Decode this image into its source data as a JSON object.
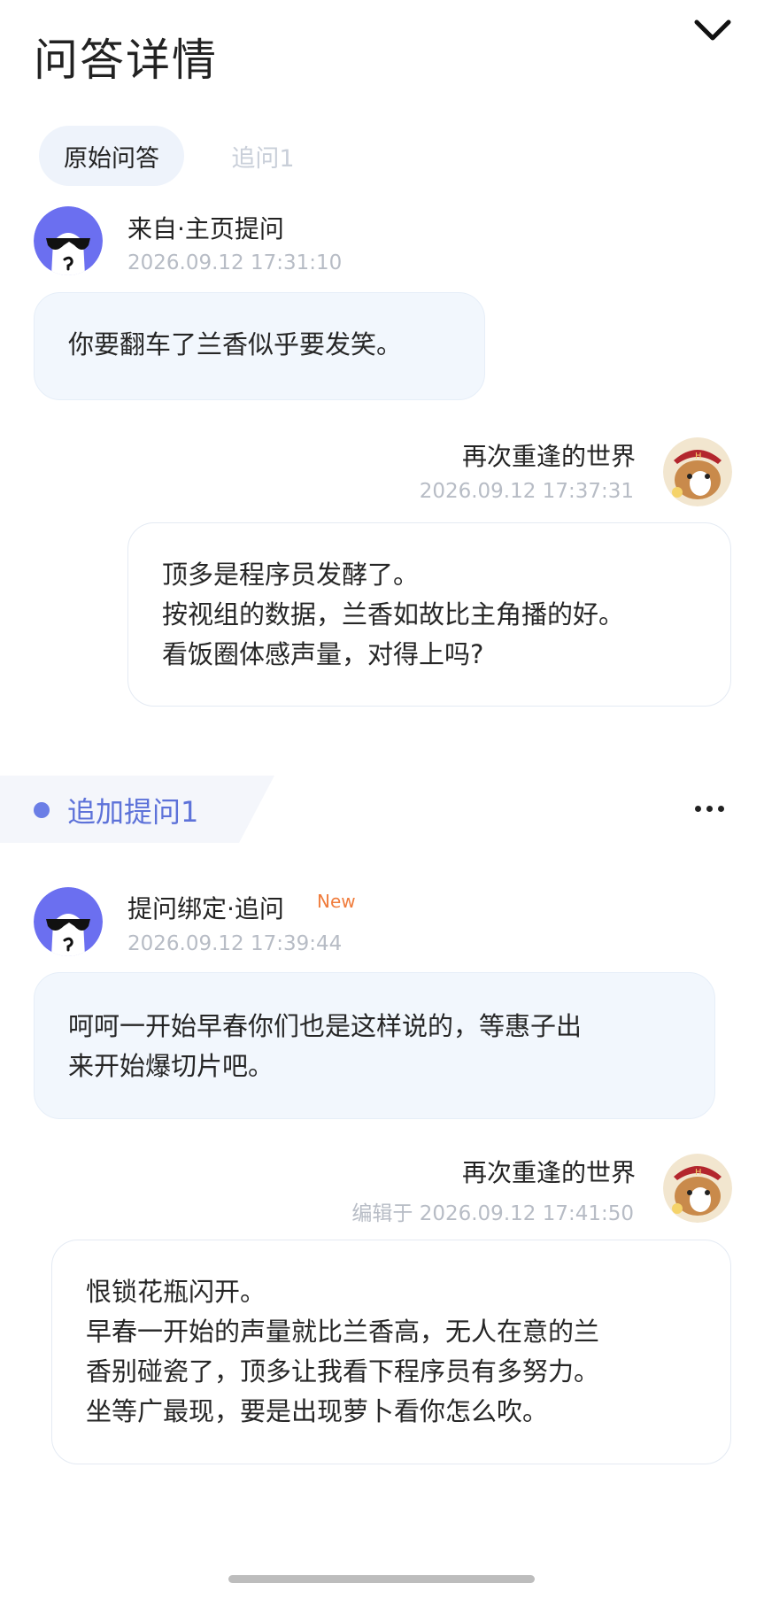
{
  "header": {
    "title": "问答详情"
  },
  "tabs": [
    {
      "label": "原始问答",
      "active": true
    },
    {
      "label": "追问1",
      "active": false
    }
  ],
  "original": {
    "question": {
      "source": "来自·主页提问",
      "time": "2026.09.12 17:31:10",
      "lines": [
        "你要翻车了兰香似乎要发笑。"
      ]
    },
    "answer": {
      "author": "再次重逢的世界",
      "time": "2026.09.12 17:37:31",
      "lines": [
        "顶多是程序员发酵了。",
        "按视组的数据，兰香如故比主角播的好。",
        "看饭圈体感声量，对得上吗?"
      ]
    }
  },
  "followup": {
    "label": "追加提问1",
    "question": {
      "source": "提问绑定·追问",
      "badge": "New",
      "time": "2026.09.12 17:39:44",
      "lines": [
        "呵呵一开始早春你们也是这样说的，等惠子出",
        "来开始爆切片吧。"
      ]
    },
    "answer": {
      "author": "再次重逢的世界",
      "time": "编辑于 2026.09.12 17:41:50",
      "lines": [
        "恨锁花瓶闪开。",
        "早春一开始的声量就比兰香高，无人在意的兰",
        "香别碰瓷了，顶多让我看下程序员有多努力。",
        "坐等广最现，要是出现萝卜看你怎么吹。"
      ]
    }
  },
  "colors": {
    "accent": "#5d72d9",
    "badge": "#f07c3c",
    "asker_avatar_bg": "#6b6ff0",
    "timestamp": "#b7bcc5"
  },
  "icons": [
    "chevron-down-icon",
    "more-icon",
    "anonymous-avatar-icon",
    "dog-avatar-icon"
  ]
}
